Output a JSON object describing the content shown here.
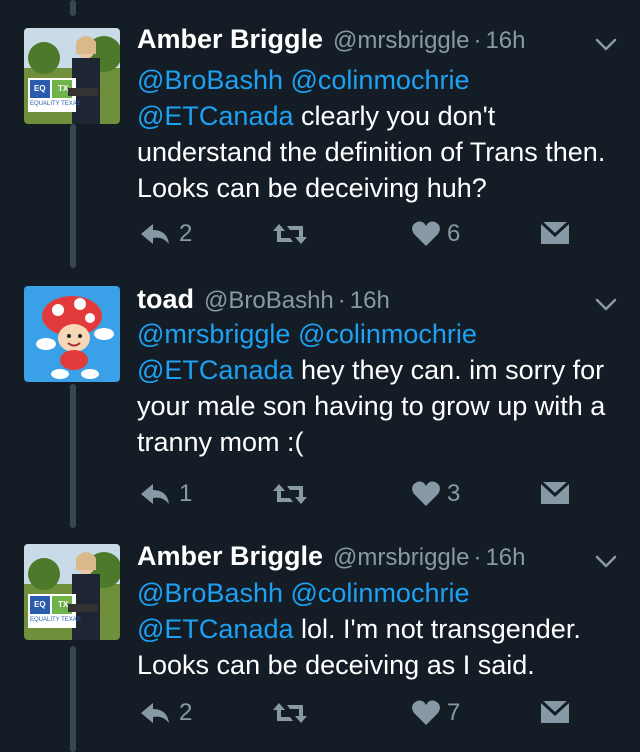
{
  "colors": {
    "background": "#141d26",
    "text": "#ffffff",
    "secondary": "#8899a6",
    "link": "#1da1f2",
    "thread": "#3a4652"
  },
  "separator": "·",
  "tweets": [
    {
      "name": "Amber Briggle",
      "handle": "@mrsbriggle",
      "time": "16h",
      "mentions": [
        "@BroBashh",
        "@colinmochrie",
        "@ETCanada"
      ],
      "text": "clearly you don't understand the definition of Trans then. Looks can be deceiving huh?",
      "reply_count": "2",
      "retweet_count": "",
      "like_count": "6",
      "avatar": {
        "sign_left": "EQ",
        "sign_right": "TX",
        "sign_bottom": "EQUALITY TEXAS"
      }
    },
    {
      "name": "toad",
      "handle": "@BroBashh",
      "time": "16h",
      "mentions": [
        "@mrsbriggle",
        "@colinmochrie",
        "@ETCanada"
      ],
      "text": "hey they can. im sorry for your male son having to grow up with a tranny mom :(",
      "reply_count": "1",
      "retweet_count": "",
      "like_count": "3",
      "avatar": {}
    },
    {
      "name": "Amber Briggle",
      "handle": "@mrsbriggle",
      "time": "16h",
      "mentions": [
        "@BroBashh",
        "@colinmochrie",
        "@ETCanada"
      ],
      "text": "lol. I'm not transgender. Looks can be deceiving as I said.",
      "reply_count": "2",
      "retweet_count": "",
      "like_count": "7",
      "avatar": {
        "sign_left": "EQ",
        "sign_right": "TX",
        "sign_bottom": "EQUALITY TEXAS"
      }
    }
  ]
}
